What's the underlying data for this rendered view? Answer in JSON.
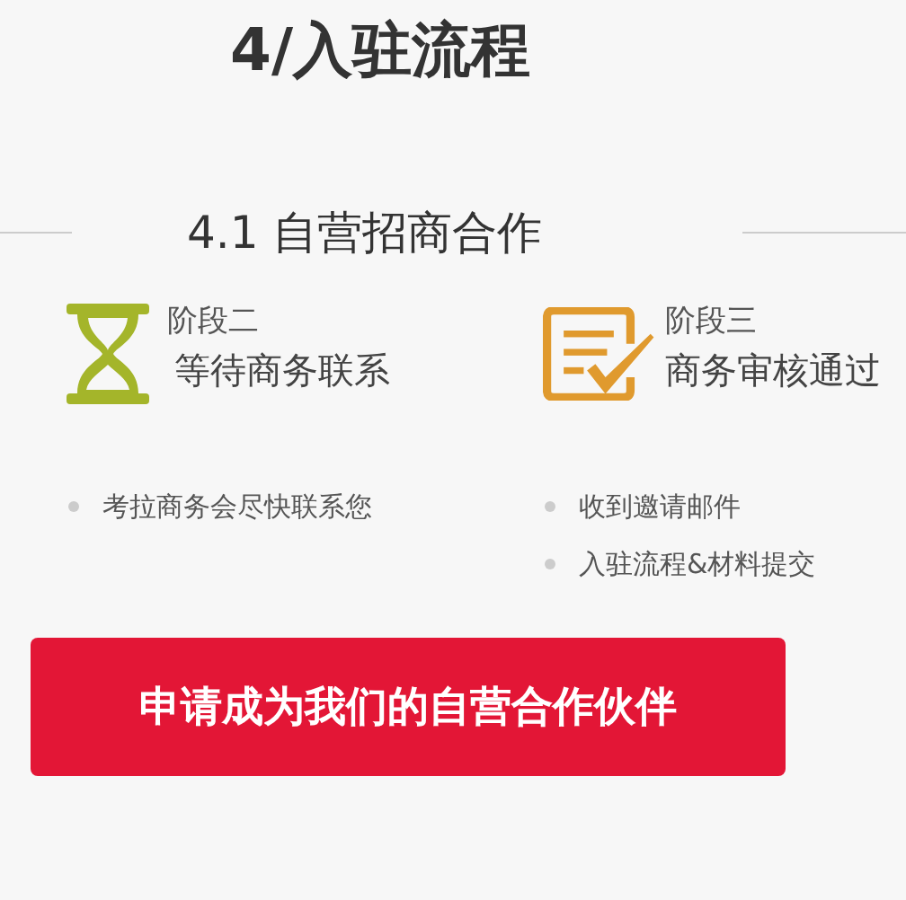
{
  "title": "4/入驻流程",
  "section": {
    "heading": "4.1 自营招商合作"
  },
  "stages": [
    {
      "kind": "hourglass",
      "label": "阶段二",
      "name": "等待商务联系",
      "bullets": [
        "考拉商务会尽快联系您"
      ]
    },
    {
      "kind": "checklist",
      "label": "阶段三",
      "name": "商务审核通过",
      "bullets": [
        "收到邀请邮件",
        "入驻流程&材料提交"
      ]
    }
  ],
  "button": {
    "label": "申请成为我们的自营合作伙伴"
  }
}
